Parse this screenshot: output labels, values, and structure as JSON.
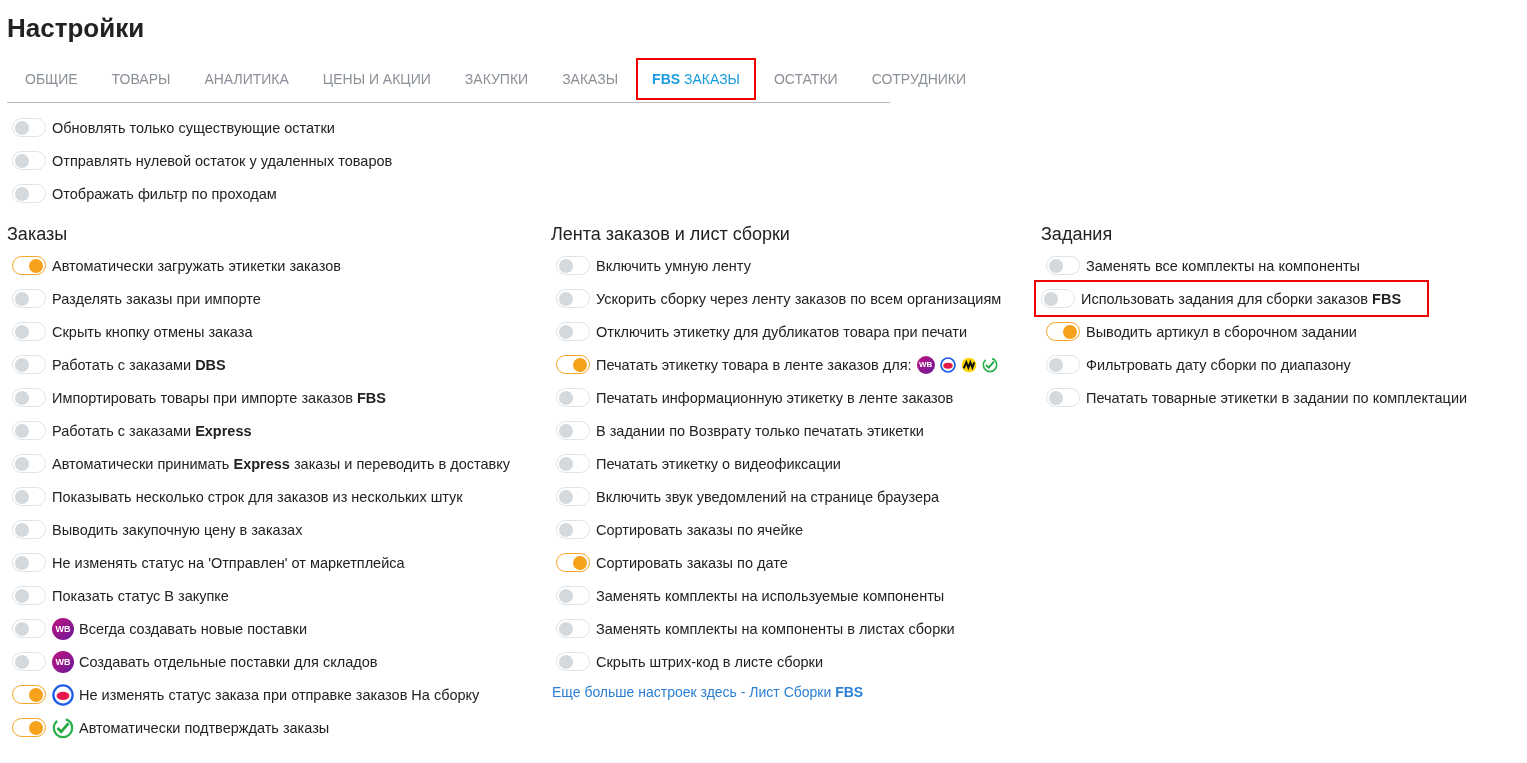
{
  "title": "Настройки",
  "tabs": [
    {
      "label": "ОБЩИЕ",
      "selected": false,
      "highlighted": false
    },
    {
      "label": "ТОВАРЫ",
      "selected": false,
      "highlighted": false
    },
    {
      "label": "АНАЛИТИКА",
      "selected": false,
      "highlighted": false
    },
    {
      "label": "ЦЕНЫ И АКЦИИ",
      "selected": false,
      "highlighted": false
    },
    {
      "label": "ЗАКУПКИ",
      "selected": false,
      "highlighted": false
    },
    {
      "label": "ЗАКАЗЫ",
      "selected": false,
      "highlighted": false
    },
    {
      "label": "**FBS** ЗАКАЗЫ",
      "selected": true,
      "highlighted": true
    },
    {
      "label": "ОСТАТКИ",
      "selected": false,
      "highlighted": false
    },
    {
      "label": "СОТРУДНИКИ",
      "selected": false,
      "highlighted": false
    }
  ],
  "general": [
    {
      "label": "Обновлять только существующие остатки",
      "on": false
    },
    {
      "label": "Отправлять нулевой остаток у удаленных товаров",
      "on": false
    },
    {
      "label": "Отображать фильтр по проходам",
      "on": false
    }
  ],
  "columns": [
    {
      "heading": "Заказы",
      "items": [
        {
          "label": "Автоматически загружать этикетки заказов",
          "on": true
        },
        {
          "label": "Разделять заказы при импорте",
          "on": false
        },
        {
          "label": "Скрыть кнопку отмены заказа",
          "on": false
        },
        {
          "label": "Работать с заказами **DBS**",
          "on": false
        },
        {
          "label": "Импортировать товары при импорте заказов **FBS**",
          "on": false
        },
        {
          "label": "Работать с заказами **Express**",
          "on": false
        },
        {
          "label": "Автоматически принимать **Express** заказы и переводить в доставку",
          "on": false
        },
        {
          "label": "Показывать несколько строк для заказов из нескольких штук",
          "on": false
        },
        {
          "label": "Выводить закупочную цену в заказах",
          "on": false
        },
        {
          "label": "Не изменять статус на 'Отправлен' от маркетплейса",
          "on": false
        },
        {
          "label": "Показать статус В закупке",
          "on": false
        },
        {
          "label": "Всегда создавать новые поставки",
          "on": false,
          "icon": {
            "kind": "wb",
            "text": "WB"
          }
        },
        {
          "label": "Создавать отдельные поставки для складов",
          "on": false,
          "icon": {
            "kind": "wb",
            "text": "WB"
          }
        },
        {
          "label": "Не изменять статус заказа при отправке заказов На сборку",
          "on": true,
          "icon": {
            "kind": "ozon"
          }
        },
        {
          "label": "Автоматически подтверждать заказы",
          "on": true,
          "icon": {
            "kind": "check"
          }
        }
      ]
    },
    {
      "heading": "Лента заказов и лист сборки",
      "items": [
        {
          "label": "Включить умную ленту",
          "on": false
        },
        {
          "label": "Ускорить сборку через ленту заказов по всем организациям",
          "on": false
        },
        {
          "label": "Отключить этикетку для дубликатов товара при печати",
          "on": false
        },
        {
          "label": "Печатать этикетку товара в ленте заказов  для:",
          "on": true,
          "trailing_icons": [
            {
              "kind": "wb",
              "text": "WB"
            },
            {
              "kind": "ozon"
            },
            {
              "kind": "yandex"
            },
            {
              "kind": "check"
            }
          ]
        },
        {
          "label": "Печатать информационную этикетку в ленте заказов",
          "on": false
        },
        {
          "label": "В задании по Возврату только печатать этикетки",
          "on": false
        },
        {
          "label": "Печатать этикетку о видеофиксации",
          "on": false
        },
        {
          "label": "Включить звук уведомлений на странице браузера",
          "on": false
        },
        {
          "label": "Сортировать заказы по ячейке",
          "on": false
        },
        {
          "label": "Сортировать заказы по дате",
          "on": true
        },
        {
          "label": "Заменять комплекты на используемые компоненты",
          "on": false
        },
        {
          "label": "Заменять комплекты на компоненты в листах сборки",
          "on": false
        },
        {
          "label": "Скрыть штрих-код в листе сборки",
          "on": false
        }
      ],
      "link": "Еще больше настроек здесь - Лист Сборки **FBS**"
    },
    {
      "heading": "Задания",
      "items": [
        {
          "label": "Заменять все комплекты на компоненты",
          "on": false
        },
        {
          "label": "Использовать задания для сборки заказов **FBS**",
          "on": false,
          "highlighted": true
        },
        {
          "label": "Выводить артикул в сборочном задании",
          "on": true
        },
        {
          "label": "Фильтровать дату сборки по диапазону",
          "on": false
        },
        {
          "label": "Печатать товарные этикетки в задании по комплектации",
          "on": false
        }
      ]
    }
  ]
}
